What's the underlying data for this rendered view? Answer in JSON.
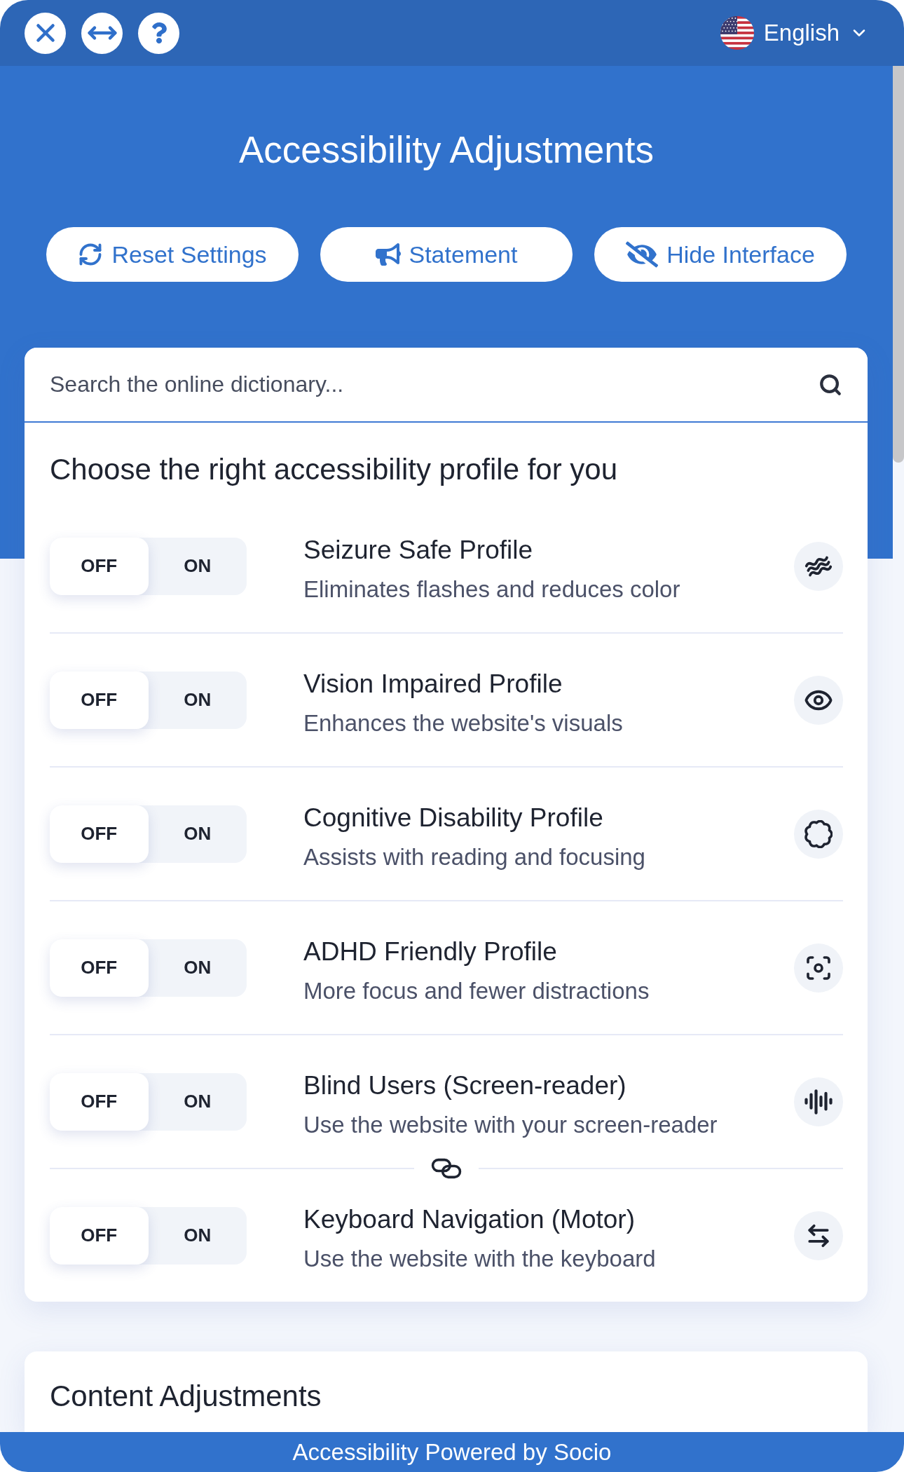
{
  "top_bar": {
    "language": "English"
  },
  "header": {
    "title": "Accessibility Adjustments",
    "buttons": [
      {
        "label": "Reset Settings"
      },
      {
        "label": "Statement"
      },
      {
        "label": "Hide Interface"
      }
    ]
  },
  "search": {
    "placeholder": "Search the online dictionary..."
  },
  "profiles_section": {
    "heading": "Choose the right accessibility profile for you",
    "profiles": [
      {
        "name": "Seizure Safe Profile",
        "description": "Eliminates flashes and reduces color",
        "off_label": "OFF",
        "on_label": "ON",
        "on": false
      },
      {
        "name": "Vision Impaired Profile",
        "description": "Enhances the website's visuals",
        "off_label": "OFF",
        "on_label": "ON",
        "on": false,
        "linked": false
      },
      {
        "name": "Cognitive Disability Profile",
        "description": "Assists with reading and focusing",
        "off_label": "OFF",
        "on_label": "ON",
        "on": false,
        "linked": false
      },
      {
        "name": "ADHD Friendly Profile",
        "description": "More focus and fewer distractions",
        "off_label": "OFF",
        "on_label": "ON",
        "on": false,
        "linked": false
      },
      {
        "name": "Blind Users (Screen-reader)",
        "description": "Use the website with your screen-reader",
        "off_label": "OFF",
        "on_label": "ON",
        "on": false,
        "linked": false
      },
      {
        "name": "Keyboard Navigation (Motor)",
        "description": "Use the website with the keyboard",
        "off_label": "OFF",
        "on_label": "ON",
        "on": false,
        "linked": true
      }
    ]
  },
  "content_section": {
    "heading": "Content Adjustments"
  },
  "footer": {
    "text": "Accessibility Powered by Socio"
  }
}
